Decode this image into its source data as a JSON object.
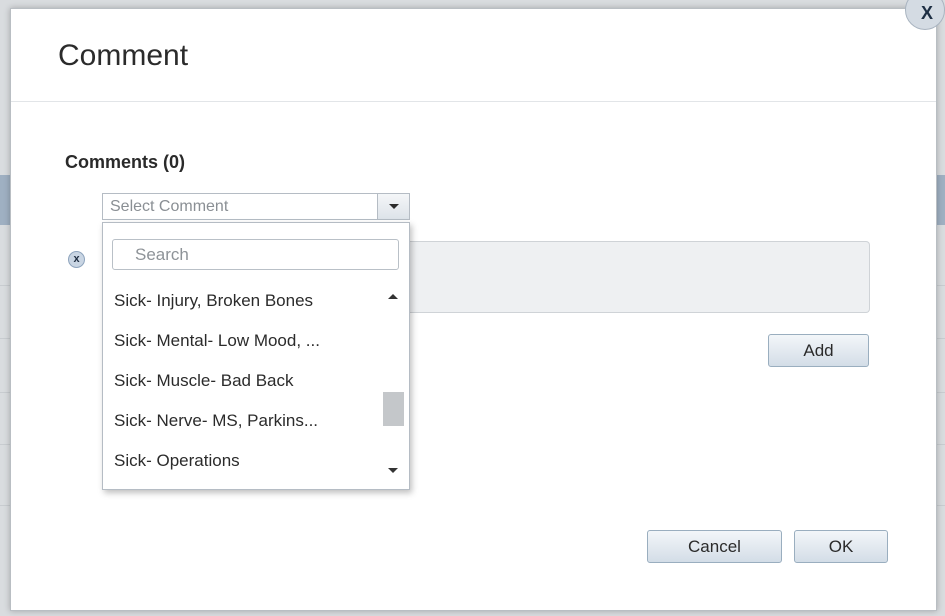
{
  "dialog": {
    "title": "Comment",
    "close_label": "X"
  },
  "comments": {
    "label": "Comments (0)",
    "select_placeholder": "Select Comment",
    "remove_label": "x",
    "add_label": "Add"
  },
  "dropdown": {
    "search_placeholder": "Search",
    "items": [
      "Sick- Injury, Broken Bones",
      "Sick- Mental- Low Mood, ...",
      "Sick- Muscle- Bad Back",
      "Sick- Nerve- MS, Parkins...",
      "Sick- Operations"
    ]
  },
  "footer": {
    "cancel_label": "Cancel",
    "ok_label": "OK"
  },
  "colors": {
    "button_border": "#9aaebf",
    "accent_icon": "#c9d5e3"
  }
}
